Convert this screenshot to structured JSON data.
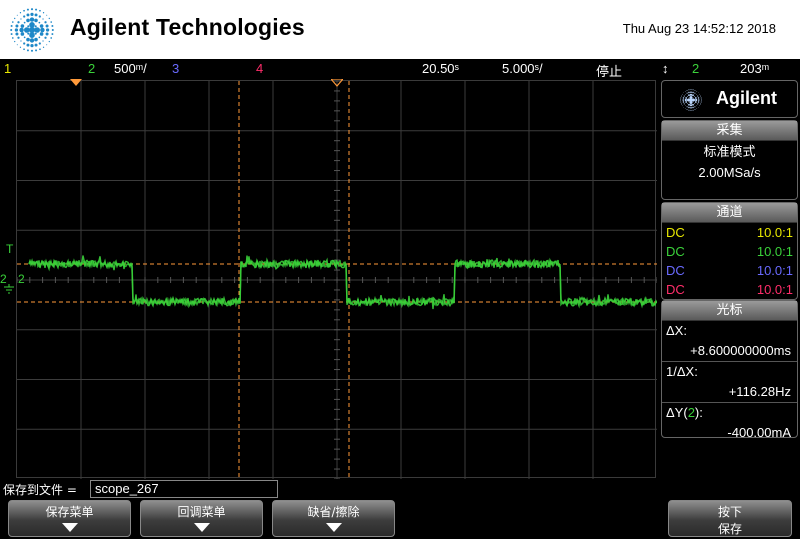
{
  "header": {
    "brand": "Agilent Technologies",
    "datetime": "Thu Aug 23 14:52:12 2018",
    "logo_icon": "agilent-spark-icon"
  },
  "statusbar": {
    "ch1": "1",
    "ch2": "2",
    "ch2_scale": "500ᵐ/",
    "ch3": "3",
    "ch4": "4",
    "time_pos": "20.50ˢ",
    "time_scale": "5.000ˢ/",
    "run_state": "停止",
    "trigger_icon": "trigger-updown-icon",
    "trig_ch": "2",
    "trig_level": "203ᵐ"
  },
  "graticule": {
    "trig_marker": "T",
    "ch2_marker": "2",
    "ground_icon": "ground-icon"
  },
  "panel": {
    "brand": "Agilent",
    "acquire": {
      "title": "采集",
      "mode": "标准模式",
      "rate": "2.00MSa/s"
    },
    "channels": {
      "title": "通道",
      "rows": [
        {
          "coupling": "DC",
          "probe": "10.0:1",
          "color": "#e8e800"
        },
        {
          "coupling": "DC",
          "probe": "10.0:1",
          "color": "#3ad23a"
        },
        {
          "coupling": "DC",
          "probe": "10.0:1",
          "color": "#6a6aff"
        },
        {
          "coupling": "DC",
          "probe": "10.0:1",
          "color": "#ff2d6a"
        }
      ]
    },
    "cursors": {
      "title": "光标",
      "dx_label": "ΔX:",
      "dx_value": "+8.600000000ms",
      "inv_label": "1/ΔX:",
      "inv_value": "+116.28Hz",
      "dy_label_prefix": "ΔY(",
      "dy_label_ch": "2",
      "dy_label_suffix": "):",
      "dy_value": "-400.00mA"
    }
  },
  "save": {
    "label": "保存到文件 =",
    "filename": "scope_267"
  },
  "softkeys": {
    "save_menu": "保存菜单",
    "recall_menu": "回调菜单",
    "default_erase": "缺省/擦除",
    "press_save_line1": "按下",
    "press_save_line2": "保存"
  },
  "waveform": {
    "color": "#3ad23a",
    "cursor_color": "#ff9a3a",
    "high_level": "+0.0 V",
    "low_level": "-400 mA",
    "period_ms": 8.6
  }
}
